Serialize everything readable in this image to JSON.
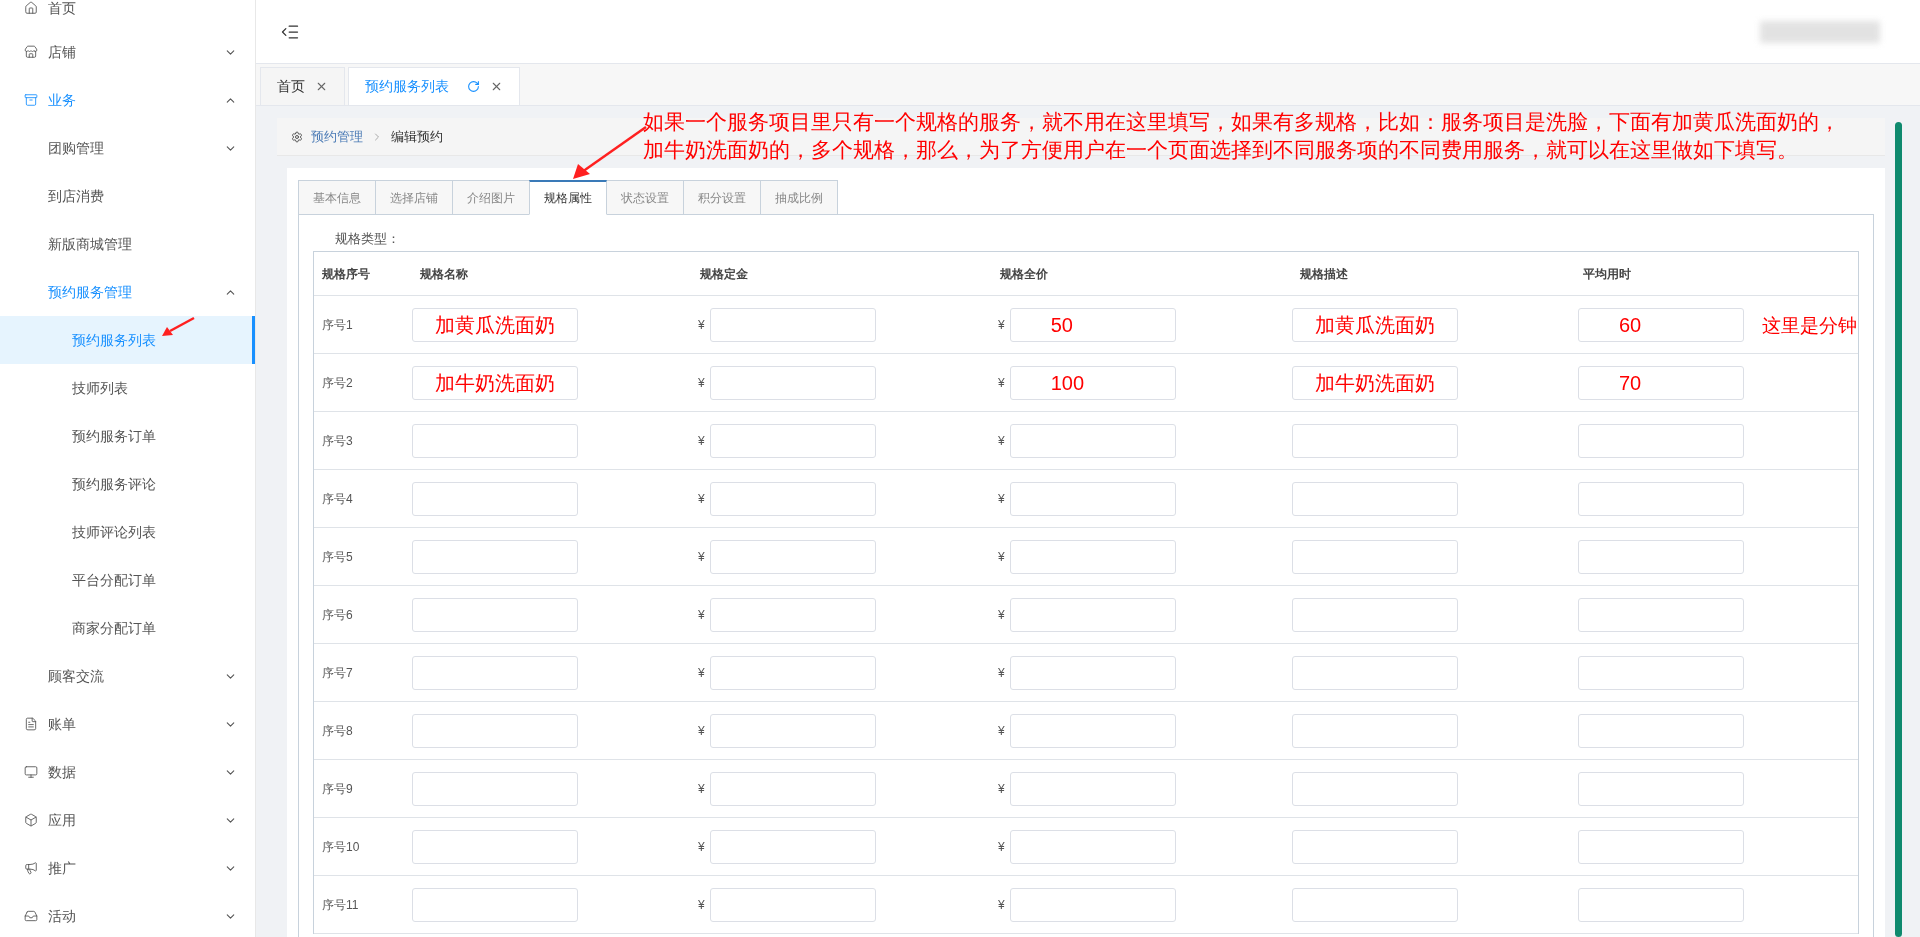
{
  "sidebar": {
    "items": [
      {
        "label": "首页",
        "selected": false
      },
      {
        "label": "店铺",
        "expanded": false,
        "selected": false
      },
      {
        "label": "业务",
        "expanded": true,
        "selected": false,
        "children": [
          {
            "label": "团购管理",
            "expanded": false,
            "selected": false
          },
          {
            "label": "到店消费",
            "selected": false
          },
          {
            "label": "新版商城管理",
            "selected": false
          },
          {
            "label": "预约服务管理",
            "expanded": true,
            "selected": false,
            "children": [
              {
                "label": "预约服务列表",
                "selected": true
              },
              {
                "label": "技师列表",
                "selected": false
              },
              {
                "label": "预约服务订单",
                "selected": false
              },
              {
                "label": "预约服务评论",
                "selected": false
              },
              {
                "label": "技师评论列表",
                "selected": false
              },
              {
                "label": "平台分配订单",
                "selected": false
              },
              {
                "label": "商家分配订单",
                "selected": false
              }
            ]
          },
          {
            "label": "顾客交流",
            "expanded": false,
            "selected": false
          }
        ]
      },
      {
        "label": "账单",
        "expanded": false,
        "selected": false
      },
      {
        "label": "数据",
        "expanded": false,
        "selected": false
      },
      {
        "label": "应用",
        "expanded": false,
        "selected": false
      },
      {
        "label": "推广",
        "expanded": false,
        "selected": false
      },
      {
        "label": "活动",
        "expanded": false,
        "selected": false
      }
    ]
  },
  "page_tabs": [
    {
      "label": "首页",
      "selected": false
    },
    {
      "label": "预约服务列表",
      "selected": true
    }
  ],
  "breadcrumb": [
    "预约管理",
    "编辑预约"
  ],
  "form_tabs": [
    {
      "label": "基本信息",
      "selected": false
    },
    {
      "label": "选择店铺",
      "selected": false
    },
    {
      "label": "介绍图片",
      "selected": false
    },
    {
      "label": "规格属性",
      "selected": true
    },
    {
      "label": "状态设置",
      "selected": false
    },
    {
      "label": "积分设置",
      "selected": false
    },
    {
      "label": "抽成比例",
      "selected": false
    }
  ],
  "spec_type_label": "规格类型：",
  "table": {
    "columns": [
      "规格序号",
      "规格名称",
      "规格定金",
      "规格全价",
      "规格描述",
      "平均用时"
    ],
    "rows": [
      {
        "seq": "序号1",
        "name": "加黄瓜洗面奶",
        "deposit_currency": "¥",
        "price_currency": "¥",
        "full_price": "50",
        "description": "加黄瓜洗面奶",
        "avg_time": "60"
      },
      {
        "seq": "序号2",
        "name": "加牛奶洗面奶",
        "deposit_currency": "¥",
        "price_currency": "¥",
        "full_price": "100",
        "description": "加牛奶洗面奶",
        "avg_time": "70"
      },
      {
        "seq": "序号3",
        "deposit_currency": "¥",
        "price_currency": "¥"
      },
      {
        "seq": "序号4",
        "deposit_currency": "¥",
        "price_currency": "¥"
      },
      {
        "seq": "序号5",
        "deposit_currency": "¥",
        "price_currency": "¥"
      },
      {
        "seq": "序号6",
        "deposit_currency": "¥",
        "price_currency": "¥"
      },
      {
        "seq": "序号7",
        "deposit_currency": "¥",
        "price_currency": "¥"
      },
      {
        "seq": "序号8",
        "deposit_currency": "¥",
        "price_currency": "¥"
      },
      {
        "seq": "序号9",
        "deposit_currency": "¥",
        "price_currency": "¥"
      },
      {
        "seq": "序号10",
        "deposit_currency": "¥",
        "price_currency": "¥"
      },
      {
        "seq": "序号11",
        "deposit_currency": "¥",
        "price_currency": "¥"
      }
    ]
  },
  "annotations": {
    "tab_note": [
      "如果一个服务项目里只有一个规格的服务，就不用在这里填写，如果有多规格，比如：服务项目是洗脸，下面有加黄瓜洗面奶的，",
      "加牛奶洗面奶的，多个规格，那么，为了方便用户在一个页面选择到不同服务项的不同费用服务，就可以在这里做如下填写。"
    ],
    "time_note": "这里是分钟"
  }
}
